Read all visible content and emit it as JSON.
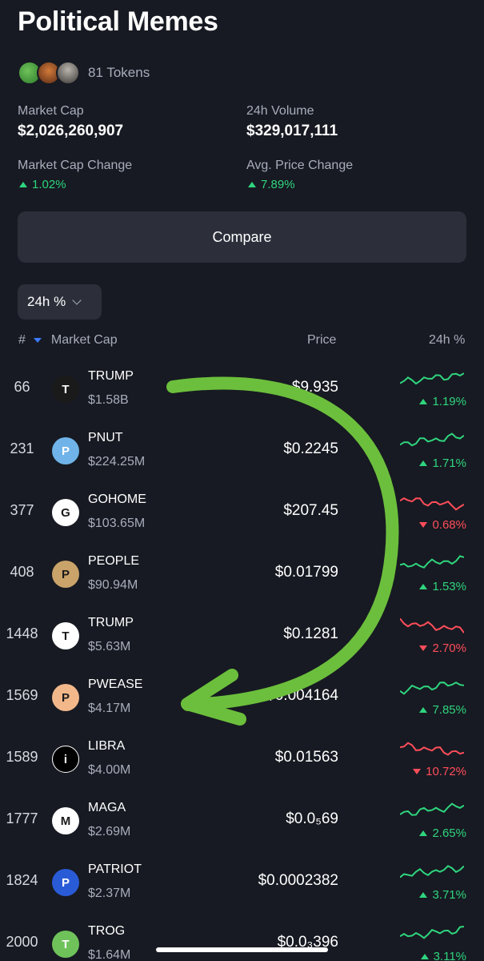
{
  "header": {
    "title": "Political Memes",
    "token_count": "81 Tokens"
  },
  "stats": {
    "market_cap_label": "Market Cap",
    "market_cap_value": "$2,026,260,907",
    "volume_label": "24h Volume",
    "volume_value": "$329,017,111",
    "mcap_change_label": "Market Cap Change",
    "mcap_change_value": "1.02%",
    "avg_price_change_label": "Avg. Price Change",
    "avg_price_change_value": "7.89%"
  },
  "actions": {
    "compare_label": "Compare",
    "period_select_value": "24h %"
  },
  "table": {
    "headers": {
      "rank": "#",
      "market_cap": "Market Cap",
      "price": "Price",
      "change": "24h %"
    },
    "rows": [
      {
        "rank": "66",
        "symbol": "TRUMP",
        "market_cap": "$1.58B",
        "price": "$9.935",
        "change": "1.19%",
        "direction": "up",
        "logo_color": "#1a1a1a",
        "logo_glyph": "T"
      },
      {
        "rank": "231",
        "symbol": "PNUT",
        "market_cap": "$224.25M",
        "price": "$0.2245",
        "change": "1.71%",
        "direction": "up",
        "logo_color": "#6fb3e8",
        "logo_glyph": "P"
      },
      {
        "rank": "377",
        "symbol": "GOHOME",
        "market_cap": "$103.65M",
        "price": "$207.45",
        "change": "0.68%",
        "direction": "down",
        "logo_color": "#ffffff",
        "logo_glyph": "G"
      },
      {
        "rank": "408",
        "symbol": "PEOPLE",
        "market_cap": "$90.94M",
        "price": "$0.01799",
        "change": "1.53%",
        "direction": "up",
        "logo_color": "#c9a36a",
        "logo_glyph": "P"
      },
      {
        "rank": "1448",
        "symbol": "TRUMP",
        "market_cap": "$5.63M",
        "price": "$0.1281",
        "change": "2.70%",
        "direction": "down",
        "logo_color": "#ffffff",
        "logo_glyph": "T"
      },
      {
        "rank": "1569",
        "symbol": "PWEASE",
        "market_cap": "$4.17M",
        "price": "$0.004164",
        "change": "7.85%",
        "direction": "up",
        "logo_color": "#f2b88a",
        "logo_glyph": "P"
      },
      {
        "rank": "1589",
        "symbol": "LIBRA",
        "market_cap": "$4.00M",
        "price": "$0.01563",
        "change": "10.72%",
        "direction": "down",
        "logo_color": "#000000",
        "logo_glyph": "i"
      },
      {
        "rank": "1777",
        "symbol": "MAGA",
        "market_cap": "$2.69M",
        "price": "$0.0₅69",
        "change": "2.65%",
        "direction": "up",
        "logo_color": "#ffffff",
        "logo_glyph": "M"
      },
      {
        "rank": "1824",
        "symbol": "PATRIOT",
        "market_cap": "$2.37M",
        "price": "$0.0002382",
        "change": "3.71%",
        "direction": "up",
        "logo_color": "#2a5bd7",
        "logo_glyph": "P"
      },
      {
        "rank": "2000",
        "symbol": "TROG",
        "market_cap": "$1.64M",
        "price": "$0.0₃396",
        "change": "3.11%",
        "direction": "up",
        "logo_color": "#6fc25a",
        "logo_glyph": "T"
      }
    ]
  },
  "colors": {
    "background": "#171a22",
    "up": "#2fd57e",
    "down": "#ff4d5a",
    "annotation_arrow": "#6cbf3c",
    "sort_indicator": "#3a7bff"
  }
}
